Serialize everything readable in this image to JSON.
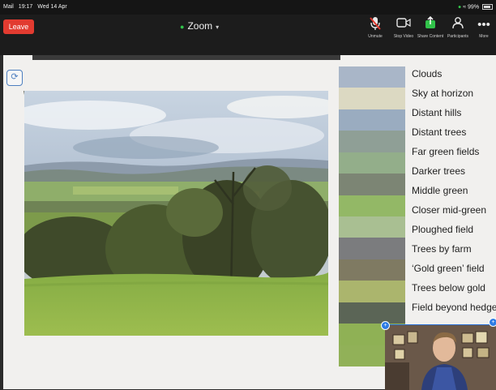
{
  "status_bar": {
    "carrier": "Mail",
    "time": "19:17",
    "date": "Wed 14 Apr",
    "battery": "99%"
  },
  "toolbar": {
    "leave_label": "Leave",
    "app_title": "Zoom",
    "tools": [
      {
        "label": "Unmute",
        "icon": "mic-muted-icon"
      },
      {
        "label": "Stop Video",
        "icon": "video-icon"
      },
      {
        "label": "Share Content",
        "icon": "share-icon"
      },
      {
        "label": "Participants",
        "icon": "participants-icon"
      },
      {
        "label": "More",
        "icon": "more-icon"
      }
    ]
  },
  "slide": {
    "swatch_colors": [
      "#a9b6c8",
      "#dcd9c2",
      "#9aacc0",
      "#8f9f96",
      "#93ae8a",
      "#7c8574",
      "#93b866",
      "#a9bf92",
      "#7b7c7e",
      "#7f7a62",
      "#abb56d",
      "#5b6556",
      "#8fb155",
      "#91b158"
    ],
    "labels": [
      "Clouds",
      "Sky at horizon",
      "Distant hills",
      "Distant trees",
      "Far green fields",
      "Darker trees",
      "Middle green",
      "Closer mid-green",
      "Ploughed field",
      "Trees by farm",
      "‘Gold green’ field",
      "Trees below gold",
      "Field beyond hedge"
    ],
    "accent": "#2d7be5"
  }
}
